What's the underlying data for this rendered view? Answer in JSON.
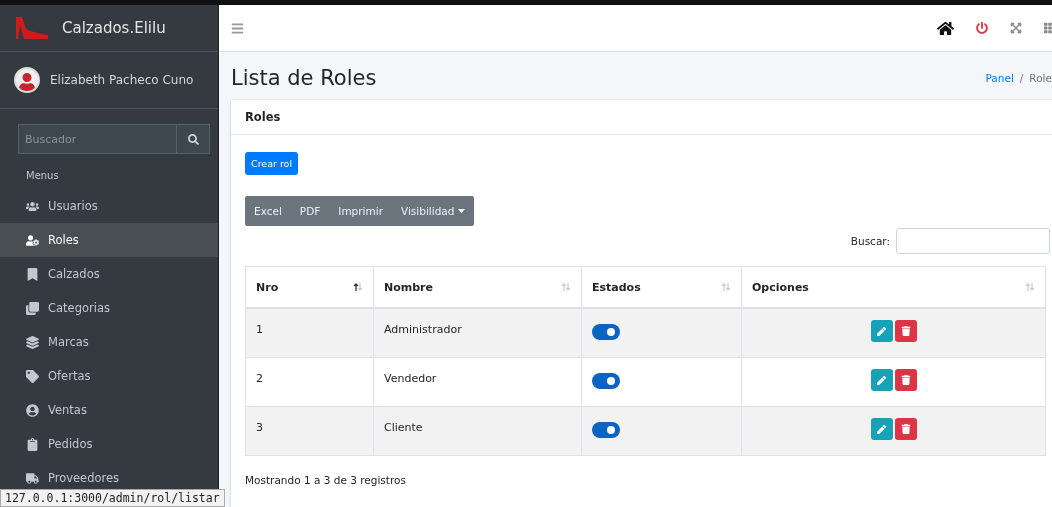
{
  "brand": {
    "name": "Calzados.Elilu"
  },
  "user": {
    "name": "Elizabeth Pacheco Cuno"
  },
  "sidebar_search": {
    "placeholder": "Buscador"
  },
  "sidebar": {
    "header": "Menus",
    "items": [
      {
        "label": "Usuarios",
        "selected": false
      },
      {
        "label": "Roles",
        "selected": true
      },
      {
        "label": "Calzados",
        "selected": false
      },
      {
        "label": "Categorias",
        "selected": false
      },
      {
        "label": "Marcas",
        "selected": false
      },
      {
        "label": "Ofertas",
        "selected": false
      },
      {
        "label": "Ventas",
        "selected": false
      },
      {
        "label": "Pedidos",
        "selected": false
      },
      {
        "label": "Proveedores",
        "selected": false
      }
    ]
  },
  "status_url": "127.0.0.1:3000/admin/rol/listar",
  "page": {
    "title": "Lista de Roles",
    "breadcrumb_separator": "/",
    "breadcrumb": [
      {
        "label": "Panel",
        "link": true
      },
      {
        "label": "Role",
        "link": false
      }
    ]
  },
  "card": {
    "title": "Roles",
    "create_button": "Crear rol",
    "export_buttons": [
      {
        "label": "Excel",
        "dropdown": false
      },
      {
        "label": "PDF",
        "dropdown": false
      },
      {
        "label": "Imprimir",
        "dropdown": false
      },
      {
        "label": "Visibilidad",
        "dropdown": true
      }
    ],
    "search_label": "Buscar:",
    "table": {
      "columns": [
        {
          "label": "Nro",
          "sorted": true
        },
        {
          "label": "Nombre",
          "sorted": false
        },
        {
          "label": "Estados",
          "sorted": false
        },
        {
          "label": "Opciones",
          "sorted": false
        }
      ],
      "rows": [
        {
          "nro": "1",
          "nombre": "Administrador",
          "on": true
        },
        {
          "nro": "2",
          "nombre": "Vendedor",
          "on": true
        },
        {
          "nro": "3",
          "nombre": "Cliente",
          "on": true
        }
      ]
    },
    "footer": "Mostrando 1 a 3 de 3 registros"
  }
}
